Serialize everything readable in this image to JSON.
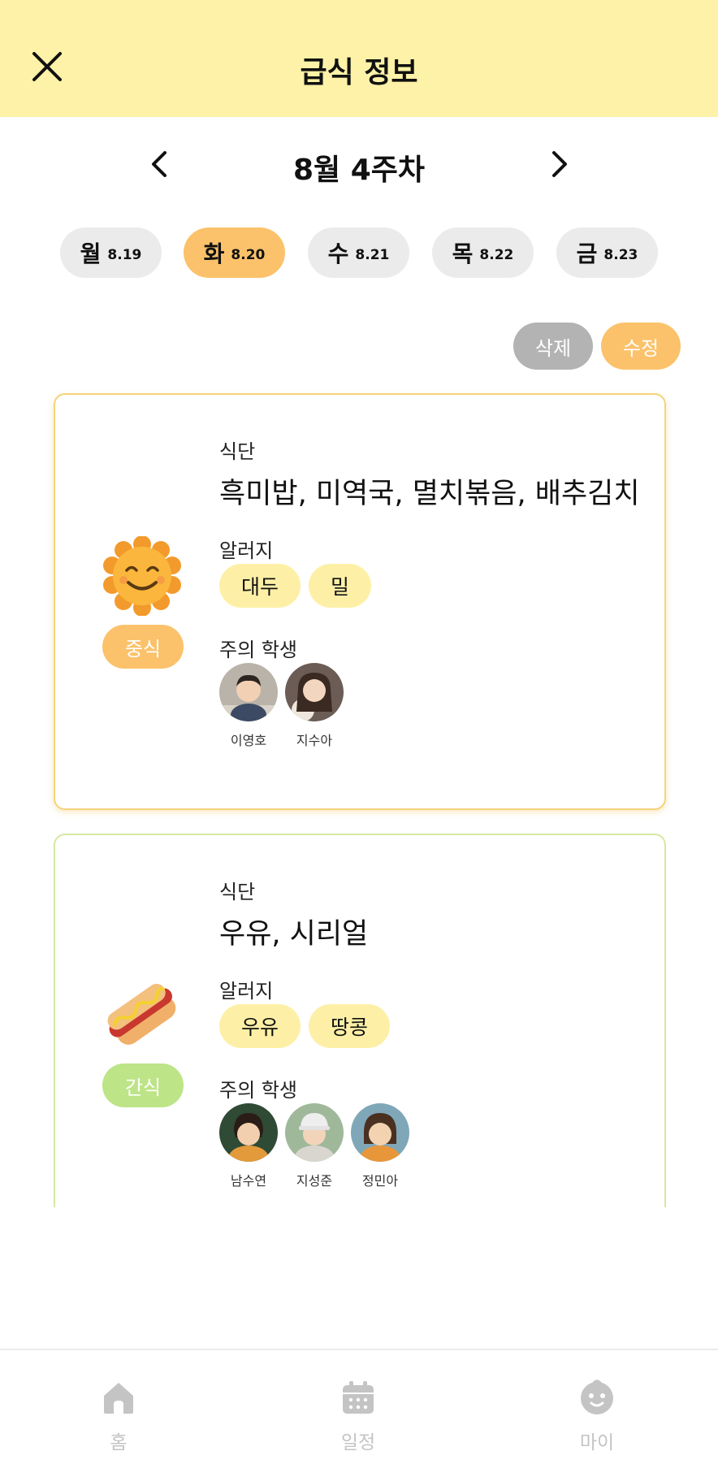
{
  "header": {
    "title": "급식 정보"
  },
  "week": {
    "label": "8월 4주차"
  },
  "days": [
    {
      "name": "월",
      "date": "8.19"
    },
    {
      "name": "화",
      "date": "8.20"
    },
    {
      "name": "수",
      "date": "8.21"
    },
    {
      "name": "목",
      "date": "8.22"
    },
    {
      "name": "금",
      "date": "8.23"
    }
  ],
  "selected_day": "화",
  "actions": {
    "delete_label": "삭제",
    "edit_label": "수정"
  },
  "meals": [
    {
      "type_label": "중식",
      "icon": "smiling-sun-icon",
      "menu_label": "식단",
      "menu": "흑미밥, 미역국, 멸치볶음, 배추김치",
      "allergy_label": "알러지",
      "allergens": [
        "대두",
        "밀"
      ],
      "students_label": "주의 학생",
      "students": [
        "이영호",
        "지수아"
      ]
    },
    {
      "type_label": "간식",
      "icon": "hotdog-icon",
      "menu_label": "식단",
      "menu": "우유, 시리얼",
      "allergy_label": "알러지",
      "allergens": [
        "우유",
        "땅콩"
      ],
      "students_label": "주의 학생",
      "students": [
        "남수연",
        "지성준",
        "정민아"
      ]
    }
  ],
  "nav": {
    "home": "홈",
    "schedule": "일정",
    "my": "마이"
  },
  "colors": {
    "header_bg": "#fdf2a7",
    "accent": "#fbc26b",
    "snack_green": "#bde487",
    "chip_bg": "#fdf0a6",
    "inactive": "#c4c4c4"
  }
}
